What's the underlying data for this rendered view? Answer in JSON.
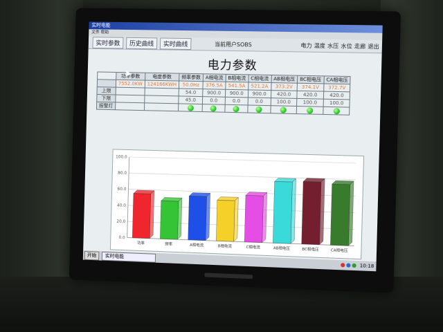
{
  "window": {
    "title": "实时电能",
    "menu": "文件 帮助"
  },
  "tabs": [
    {
      "label": "实时参数"
    },
    {
      "label": "历史曲线"
    },
    {
      "label": "实时曲线"
    }
  ],
  "user_label": "当前用户SOBS",
  "right_menu": [
    "电力",
    "温度",
    "水压",
    "水位",
    "走廊",
    "退出"
  ],
  "page_title": "电力参数",
  "table": {
    "h_total_power": "功率参数",
    "h_energy": "电度参数",
    "total_power_value": "7552.0KW",
    "energy_value": "124166KWH",
    "row_labels": [
      "上限",
      "下限",
      "报警灯"
    ],
    "columns": [
      {
        "header": "频率参数",
        "current": "50.0Hz",
        "upper": "54.0",
        "lower": "45.0"
      },
      {
        "header": "A相电流",
        "current": "376.5A",
        "upper": "900.0",
        "lower": "0.0"
      },
      {
        "header": "B相电流",
        "current": "541.5A",
        "upper": "900.0",
        "lower": "0.0"
      },
      {
        "header": "C相电流",
        "current": "521.2A",
        "upper": "900.0",
        "lower": "0.0"
      },
      {
        "header": "AB相电压",
        "current": "373.2V",
        "upper": "420.0",
        "lower": "100.0"
      },
      {
        "header": "BC相电压",
        "current": "374.1V",
        "upper": "420.0",
        "lower": "100.0"
      },
      {
        "header": "CA相电压",
        "current": "372.7V",
        "upper": "420.0",
        "lower": "100.0"
      }
    ]
  },
  "chart_data": {
    "type": "bar",
    "categories": [
      "功率",
      "频率",
      "A相电流",
      "B相电流",
      "C相电流",
      "AB相电压",
      "BC相电压",
      "CA相电压"
    ],
    "values": [
      55,
      47,
      54,
      50,
      57,
      75,
      76,
      74
    ],
    "colors": [
      "#e82830",
      "#3ac23a",
      "#2050e0",
      "#f2d030",
      "#e050e0",
      "#40d8d8",
      "#702030",
      "#3a7a30"
    ],
    "ylim": [
      0,
      100
    ],
    "yticks": [
      "0.0",
      "20.0",
      "40.0",
      "60.0",
      "80.0",
      "100.0"
    ]
  },
  "taskbar": {
    "start_label": "开始",
    "task_label": "实时电能",
    "clock": "10:18"
  }
}
